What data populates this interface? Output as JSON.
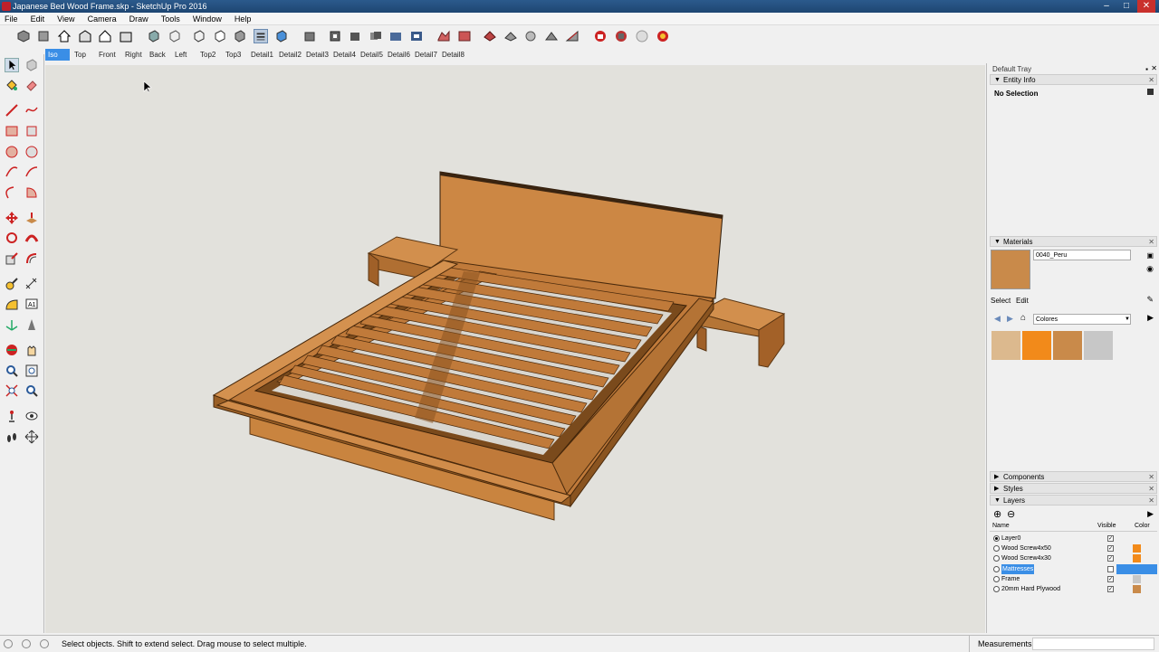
{
  "window": {
    "title": "Japanese Bed Wood Frame.skp - SketchUp Pro 2016",
    "controls": [
      "–",
      "□",
      "✕"
    ]
  },
  "menu": [
    "File",
    "Edit",
    "View",
    "Camera",
    "Draw",
    "Tools",
    "Window",
    "Help"
  ],
  "scene_tabs": [
    {
      "label": "Iso",
      "active": true
    },
    {
      "label": "Top"
    },
    {
      "label": "Front"
    },
    {
      "label": "Right"
    },
    {
      "label": "Back"
    },
    {
      "label": "Left"
    },
    {
      "label": "Top2"
    },
    {
      "label": "Top3"
    },
    {
      "label": "Detail1"
    },
    {
      "label": "Detail2"
    },
    {
      "label": "Detail3"
    },
    {
      "label": "Detail4"
    },
    {
      "label": "Detail5"
    },
    {
      "label": "Detail6"
    },
    {
      "label": "Detail7"
    },
    {
      "label": "Detail8"
    }
  ],
  "tray": {
    "title": "Default Tray",
    "entity_info": {
      "header": "Entity Info",
      "selection": "No Selection"
    },
    "materials": {
      "header": "Materials",
      "current_name": "0040_Peru",
      "current_color": "#c98a4a",
      "tabs": [
        "Select",
        "Edit"
      ],
      "library": "Colores",
      "swatches": [
        "#dcb98e",
        "#f28a1a",
        "#c98a4a",
        "#c7c7c7"
      ]
    },
    "components_header": "Components",
    "styles_header": "Styles",
    "layers": {
      "header": "Layers",
      "columns": {
        "name": "Name",
        "visible": "Visible",
        "color": "Color"
      },
      "rows": [
        {
          "name": "Layer0",
          "active": true,
          "visible": true,
          "color": ""
        },
        {
          "name": "Wood Screw4x50",
          "active": false,
          "visible": true,
          "color": "#f28a1a"
        },
        {
          "name": "Wood Screw4x30",
          "active": false,
          "visible": true,
          "color": "#f28a1a"
        },
        {
          "name": "Mattresses",
          "active": false,
          "visible": false,
          "color": "#3a8ee6",
          "selected": true
        },
        {
          "name": "Frame",
          "active": false,
          "visible": true,
          "color": "#c7c7c7"
        },
        {
          "name": "20mm Hard Plywood",
          "active": false,
          "visible": true,
          "color": "#c98a4a"
        }
      ]
    }
  },
  "status": {
    "hint": "Select objects. Shift to extend select. Drag mouse to select multiple.",
    "measurements_label": "Measurements"
  },
  "colors": {
    "wood": "#c98a4a",
    "wood_dark": "#9a5f26",
    "wood_light": "#d89a58",
    "selection_blue": "#3a8ee6"
  }
}
